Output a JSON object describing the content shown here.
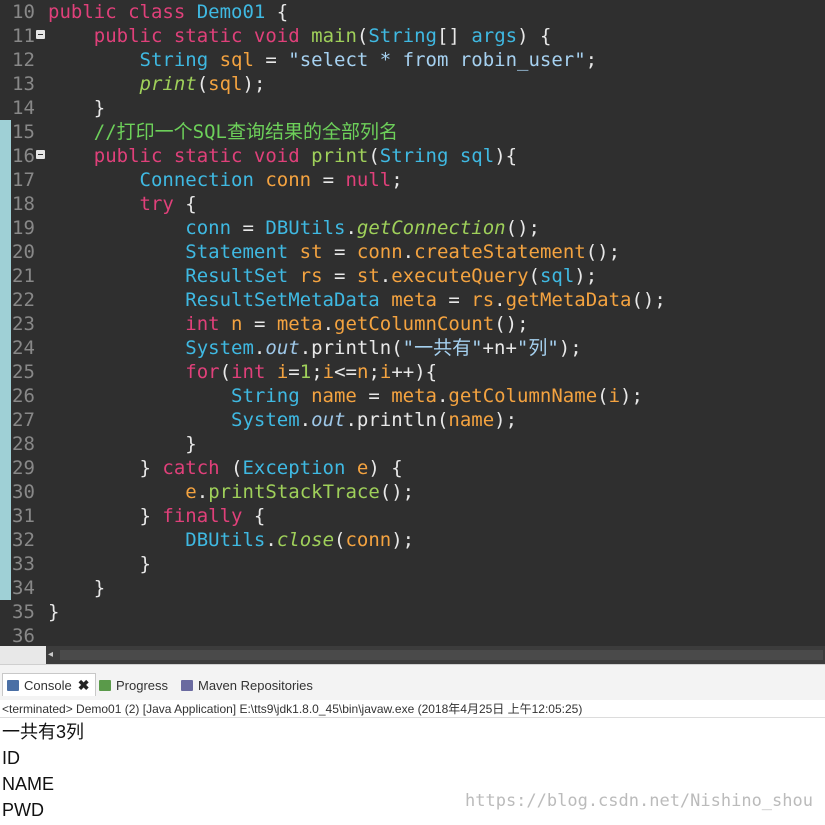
{
  "editor": {
    "lines": [
      {
        "n": "10",
        "fold": false,
        "tokens": [
          [
            "kw",
            "public "
          ],
          [
            "kw",
            "class "
          ],
          [
            "cls",
            "Demo01"
          ],
          [
            "pl",
            " {"
          ]
        ]
      },
      {
        "n": "11",
        "fold": true,
        "tokens": [
          [
            "pl",
            "    "
          ],
          [
            "kw",
            "public "
          ],
          [
            "kw",
            "static "
          ],
          [
            "kw",
            "void "
          ],
          [
            "fn",
            "main"
          ],
          [
            "pl",
            "("
          ],
          [
            "type",
            "String"
          ],
          [
            "pl",
            "[] "
          ],
          [
            "type",
            "args"
          ],
          [
            "pl",
            ") {"
          ]
        ]
      },
      {
        "n": "12",
        "fold": false,
        "tokens": [
          [
            "pl",
            "        "
          ],
          [
            "type",
            "String "
          ],
          [
            "var",
            "sql"
          ],
          [
            "pl",
            " = "
          ],
          [
            "str",
            "\"select * from robin_user\""
          ],
          [
            "pl",
            ";"
          ]
        ]
      },
      {
        "n": "13",
        "fold": false,
        "tokens": [
          [
            "pl",
            "        "
          ],
          [
            "fn-it",
            "print"
          ],
          [
            "pl",
            "("
          ],
          [
            "var",
            "sql"
          ],
          [
            "pl",
            ");"
          ]
        ]
      },
      {
        "n": "14",
        "fold": false,
        "tokens": [
          [
            "pl",
            "    }"
          ]
        ]
      },
      {
        "n": "15",
        "fold": false,
        "tokens": [
          [
            "pl",
            "    "
          ],
          [
            "com",
            "//打印一个SQL查询结果的全部列名"
          ]
        ]
      },
      {
        "n": "16",
        "fold": true,
        "tokens": [
          [
            "pl",
            "    "
          ],
          [
            "kw",
            "public "
          ],
          [
            "kw",
            "static "
          ],
          [
            "kw",
            "void "
          ],
          [
            "fn",
            "print"
          ],
          [
            "pl",
            "("
          ],
          [
            "type",
            "String "
          ],
          [
            "type",
            "sql"
          ],
          [
            "pl",
            "){"
          ]
        ]
      },
      {
        "n": "17",
        "fold": false,
        "tokens": [
          [
            "pl",
            "        "
          ],
          [
            "type",
            "Connection "
          ],
          [
            "var",
            "conn"
          ],
          [
            "pl",
            " = "
          ],
          [
            "kw",
            "null"
          ],
          [
            "pl",
            ";"
          ]
        ]
      },
      {
        "n": "18",
        "fold": false,
        "tokens": [
          [
            "pl",
            "        "
          ],
          [
            "kw",
            "try"
          ],
          [
            "pl",
            " {"
          ]
        ]
      },
      {
        "n": "19",
        "fold": false,
        "tokens": [
          [
            "pl",
            "            "
          ],
          [
            "type",
            "conn"
          ],
          [
            "pl",
            " = "
          ],
          [
            "cls",
            "DBUtils"
          ],
          [
            "pl",
            "."
          ],
          [
            "fn-it",
            "getConnection"
          ],
          [
            "pl",
            "();"
          ]
        ]
      },
      {
        "n": "20",
        "fold": false,
        "tokens": [
          [
            "pl",
            "            "
          ],
          [
            "type",
            "Statement "
          ],
          [
            "var",
            "st"
          ],
          [
            "pl",
            " = "
          ],
          [
            "var",
            "conn"
          ],
          [
            "pl",
            "."
          ],
          [
            "var",
            "createStatement"
          ],
          [
            "pl",
            "();"
          ]
        ]
      },
      {
        "n": "21",
        "fold": false,
        "tokens": [
          [
            "pl",
            "            "
          ],
          [
            "type",
            "ResultSet "
          ],
          [
            "var",
            "rs"
          ],
          [
            "pl",
            " = "
          ],
          [
            "var",
            "st"
          ],
          [
            "pl",
            "."
          ],
          [
            "var",
            "executeQuery"
          ],
          [
            "pl",
            "("
          ],
          [
            "type",
            "sql"
          ],
          [
            "pl",
            ");"
          ]
        ]
      },
      {
        "n": "22",
        "fold": false,
        "tokens": [
          [
            "pl",
            "            "
          ],
          [
            "type",
            "ResultSetMetaData "
          ],
          [
            "var",
            "meta"
          ],
          [
            "pl",
            " = "
          ],
          [
            "var",
            "rs"
          ],
          [
            "pl",
            "."
          ],
          [
            "var",
            "getMetaData"
          ],
          [
            "pl",
            "();"
          ]
        ]
      },
      {
        "n": "23",
        "fold": false,
        "tokens": [
          [
            "pl",
            "            "
          ],
          [
            "kw",
            "int "
          ],
          [
            "var",
            "n"
          ],
          [
            "pl",
            " = "
          ],
          [
            "var",
            "meta"
          ],
          [
            "pl",
            "."
          ],
          [
            "var",
            "getColumnCount"
          ],
          [
            "pl",
            "();"
          ]
        ]
      },
      {
        "n": "24",
        "fold": false,
        "tokens": [
          [
            "pl",
            "            "
          ],
          [
            "cls",
            "System"
          ],
          [
            "pl",
            "."
          ],
          [
            "fld-it",
            "out"
          ],
          [
            "pl",
            ".println("
          ],
          [
            "str",
            "\"一共有\""
          ],
          [
            "pl",
            "+"
          ],
          [
            "pl",
            "n"
          ],
          [
            "pl",
            "+"
          ],
          [
            "str",
            "\"列\""
          ],
          [
            "pl",
            ");"
          ]
        ]
      },
      {
        "n": "25",
        "fold": false,
        "tokens": [
          [
            "pl",
            "            "
          ],
          [
            "kw",
            "for"
          ],
          [
            "pl",
            "("
          ],
          [
            "kw",
            "int "
          ],
          [
            "var",
            "i"
          ],
          [
            "pl",
            "="
          ],
          [
            "fn",
            "1"
          ],
          [
            "pl",
            ";"
          ],
          [
            "var",
            "i"
          ],
          [
            "pl",
            "<="
          ],
          [
            "var",
            "n"
          ],
          [
            "pl",
            ";"
          ],
          [
            "var",
            "i"
          ],
          [
            "pl",
            "++){"
          ]
        ]
      },
      {
        "n": "26",
        "fold": false,
        "tokens": [
          [
            "pl",
            "                "
          ],
          [
            "type",
            "String "
          ],
          [
            "var",
            "name"
          ],
          [
            "pl",
            " = "
          ],
          [
            "var",
            "meta"
          ],
          [
            "pl",
            "."
          ],
          [
            "var",
            "getColumnName"
          ],
          [
            "pl",
            "("
          ],
          [
            "var",
            "i"
          ],
          [
            "pl",
            ");"
          ]
        ]
      },
      {
        "n": "27",
        "fold": false,
        "tokens": [
          [
            "pl",
            "                "
          ],
          [
            "cls",
            "System"
          ],
          [
            "pl",
            "."
          ],
          [
            "fld-it",
            "out"
          ],
          [
            "pl",
            ".println("
          ],
          [
            "var",
            "name"
          ],
          [
            "pl",
            ");"
          ]
        ]
      },
      {
        "n": "28",
        "fold": false,
        "tokens": [
          [
            "pl",
            "            }"
          ]
        ]
      },
      {
        "n": "29",
        "fold": false,
        "tokens": [
          [
            "pl",
            "        } "
          ],
          [
            "kw",
            "catch"
          ],
          [
            "pl",
            " ("
          ],
          [
            "type",
            "Exception "
          ],
          [
            "var",
            "e"
          ],
          [
            "pl",
            ") {"
          ]
        ]
      },
      {
        "n": "30",
        "fold": false,
        "tokens": [
          [
            "pl",
            "            "
          ],
          [
            "var",
            "e"
          ],
          [
            "pl",
            "."
          ],
          [
            "fn",
            "printStackTrace"
          ],
          [
            "pl",
            "();"
          ]
        ]
      },
      {
        "n": "31",
        "fold": false,
        "tokens": [
          [
            "pl",
            "        } "
          ],
          [
            "kw",
            "finally"
          ],
          [
            "pl",
            " {"
          ]
        ]
      },
      {
        "n": "32",
        "fold": false,
        "tokens": [
          [
            "pl",
            "            "
          ],
          [
            "cls",
            "DBUtils"
          ],
          [
            "pl",
            "."
          ],
          [
            "fn-it",
            "close"
          ],
          [
            "pl",
            "("
          ],
          [
            "var",
            "conn"
          ],
          [
            "pl",
            ");"
          ]
        ]
      },
      {
        "n": "33",
        "fold": false,
        "tokens": [
          [
            "pl",
            "        }"
          ]
        ]
      },
      {
        "n": "34",
        "fold": false,
        "tokens": [
          [
            "pl",
            "    }"
          ]
        ]
      },
      {
        "n": "35",
        "fold": false,
        "tokens": [
          [
            "pl",
            "}"
          ]
        ]
      },
      {
        "n": "36",
        "fold": false,
        "tokens": []
      }
    ]
  },
  "console": {
    "tabs": [
      {
        "label": "Console",
        "active": true,
        "icon": "console-icon",
        "icon_color": "#4a6fa5",
        "closable": true
      },
      {
        "label": "Progress",
        "active": false,
        "icon": "progress-icon",
        "icon_color": "#5a9a4a",
        "closable": false
      },
      {
        "label": "Maven Repositories",
        "active": false,
        "icon": "maven-repositories-icon",
        "icon_color": "#6a6aa0",
        "closable": false
      }
    ],
    "close_glyph": "✖",
    "status": "<terminated> Demo01 (2) [Java Application] E:\\tts9\\jdk1.8.0_45\\bin\\javaw.exe (2018年4月25日 上午12:05:25)",
    "output": [
      "一共有3列",
      "ID",
      "NAME",
      "PWD"
    ]
  },
  "watermark": "https://blog.csdn.net/Nishino_shou",
  "colors": {
    "editor_bg": "#2f2f2f",
    "keyword": "#e0407a",
    "type": "#3fb9e2",
    "method": "#9fd05a",
    "string": "#a6d1f0",
    "variable": "#f4a340",
    "comment": "#6dd05a"
  }
}
